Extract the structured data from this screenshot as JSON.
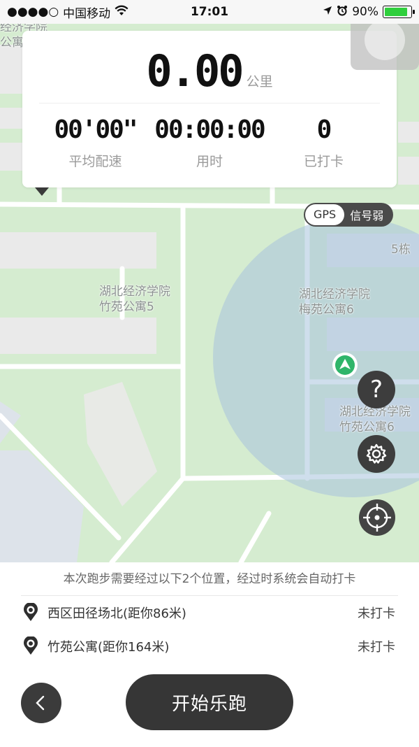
{
  "status_bar": {
    "signal_dots": "●●●●○",
    "carrier": "中国移动",
    "time": "17:01",
    "battery_percent": "90%",
    "battery_level": 0.9
  },
  "map": {
    "labels": [
      {
        "text": "湖北经济学院\n竹苑公寓5"
      },
      {
        "text": "湖北经济学院\n梅苑公寓6"
      },
      {
        "text": "湖北经济学院\n竹苑公寓6"
      },
      {
        "text": "经济学院\n公寓"
      },
      {
        "text": "5栋"
      }
    ]
  },
  "stats": {
    "distance": "0.00",
    "distance_unit": "公里",
    "pace_value": "00'00\"",
    "pace_label": "平均配速",
    "duration_value": "00:00:00",
    "duration_label": "用时",
    "checkins_value": "0",
    "checkins_label": "已打卡"
  },
  "gps": {
    "tag": "GPS",
    "status": "信号弱"
  },
  "controls": {
    "help_glyph": "?"
  },
  "panel": {
    "notice": "本次跑步需要经过以下2个位置，经过时系统会自动打卡",
    "checkpoints": [
      {
        "name": "西区田径场北(距你86米)",
        "status": "未打卡"
      },
      {
        "name": "竹苑公寓(距你164米)",
        "status": "未打卡"
      }
    ],
    "start_label": "开始乐跑"
  },
  "colors": {
    "map_green": "#d5ecd0",
    "building": "#eaeaea",
    "range_circle": "#a8c3dd",
    "button_dark": "#363636",
    "location_green": "#2fb56a"
  },
  "icons": {
    "wifi": "wifi-icon",
    "location_arrow": "location-arrow-icon",
    "alarm": "alarm-icon",
    "pin": "map-pin-icon",
    "gear": "gear-icon",
    "locate": "locate-icon",
    "back": "chevron-left-icon"
  }
}
